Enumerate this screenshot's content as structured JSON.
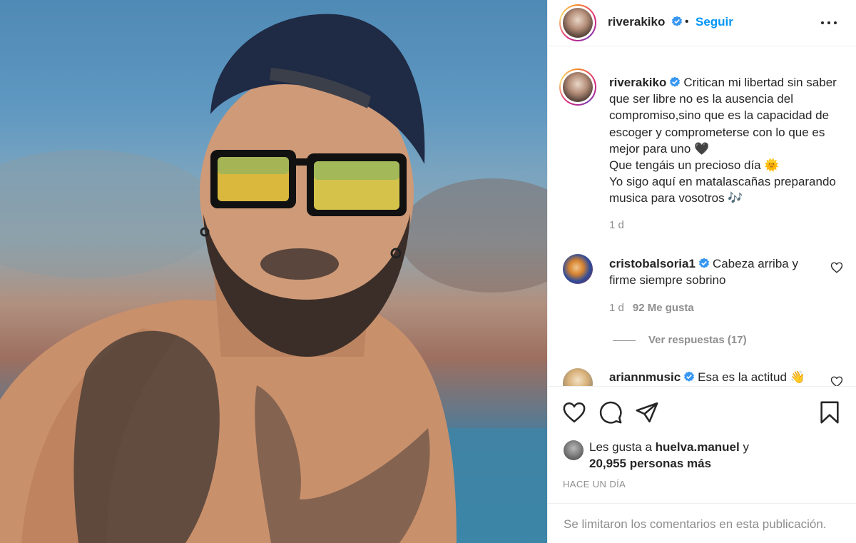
{
  "post": {
    "author": "riverakiko",
    "follow_label": "Seguir",
    "separator": "•",
    "caption": {
      "username": "riverakiko",
      "text": "Critican mi libertad sin saber que ser libre no es la ausencia del compromiso,sino que es la capacidad de escoger y comprometerse con lo que es mejor para uno 🖤",
      "line2": "Que tengáis un precioso día 🌞",
      "line3": "Yo sigo aquí en matalascañas preparando musica para vosotros 🎶",
      "time": "1 d"
    },
    "comments": [
      {
        "username": "cristobalsoria1",
        "text": "Cabeza arriba y firme siempre sobrino",
        "time": "1 d",
        "likes": "92 Me gusta",
        "replies": "Ver respuestas (17)"
      },
      {
        "username": "ariannmusic",
        "text": "Esa es la actitud 👋"
      }
    ],
    "likes": {
      "prefix": "Les gusta a",
      "user": "huelva.manuel",
      "conj": "y",
      "count": "20,955 personas más"
    },
    "posted": "HACE UN DÍA",
    "footer": "Se limitaron los comentarios en esta publicación."
  },
  "colors": {
    "accent": "#0095f6",
    "text": "#262626",
    "muted": "#8e8e8e",
    "verified": "#3897f0"
  },
  "icons": [
    "more-options-icon",
    "verified-icon",
    "heart-icon",
    "comment-icon",
    "share-icon",
    "bookmark-icon"
  ]
}
